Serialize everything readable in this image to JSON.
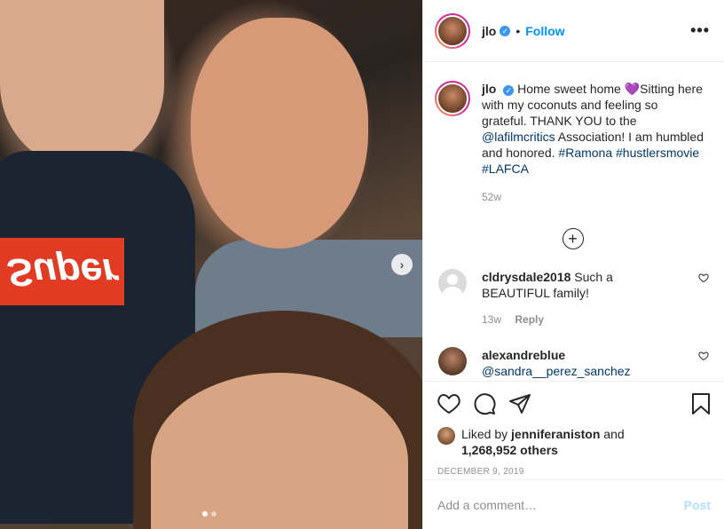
{
  "post": {
    "username": "jlo",
    "follow_label": "Follow",
    "bullet": "•",
    "more_label": "•••",
    "image_logo_text": "Super",
    "next_label": "›"
  },
  "caption": {
    "username": "jlo",
    "text1": "Home sweet home 💜Sitting here with my coconuts and feeling so grateful. THANK YOU to the",
    "mention": "@lafilmcritics",
    "text2": "Association! I am humbled and honored.",
    "tag1": "#Ramona",
    "tag2": "#hustlersmovie",
    "tag3": "#LAFCA",
    "time": "52w"
  },
  "load_more_label": "+",
  "comments": [
    {
      "username": "cldrysdale2018",
      "text": "Such a BEAUTIFUL family!",
      "time": "13w",
      "reply": "Reply"
    },
    {
      "username": "alexandreblue",
      "text": "@sandra__perez_sanchez",
      "time": "",
      "reply": ""
    }
  ],
  "likes": {
    "prefix": "Liked by",
    "user": "jenniferaniston",
    "and": "and",
    "count": "1,268,952 others"
  },
  "date": "DECEMBER 9, 2019",
  "add_comment": {
    "placeholder": "Add a comment…",
    "post_label": "Post"
  },
  "carousel": {
    "count": 2,
    "active": 1
  },
  "colors": {
    "accent": "#0095f6",
    "link": "#00376b",
    "muted": "#8e8e8e",
    "verified": "#3897f0"
  },
  "icons": [
    "more-icon",
    "verified-icon",
    "plus-circle-icon",
    "heart-icon",
    "comment-icon",
    "share-icon",
    "bookmark-icon",
    "next-arrow-icon"
  ]
}
